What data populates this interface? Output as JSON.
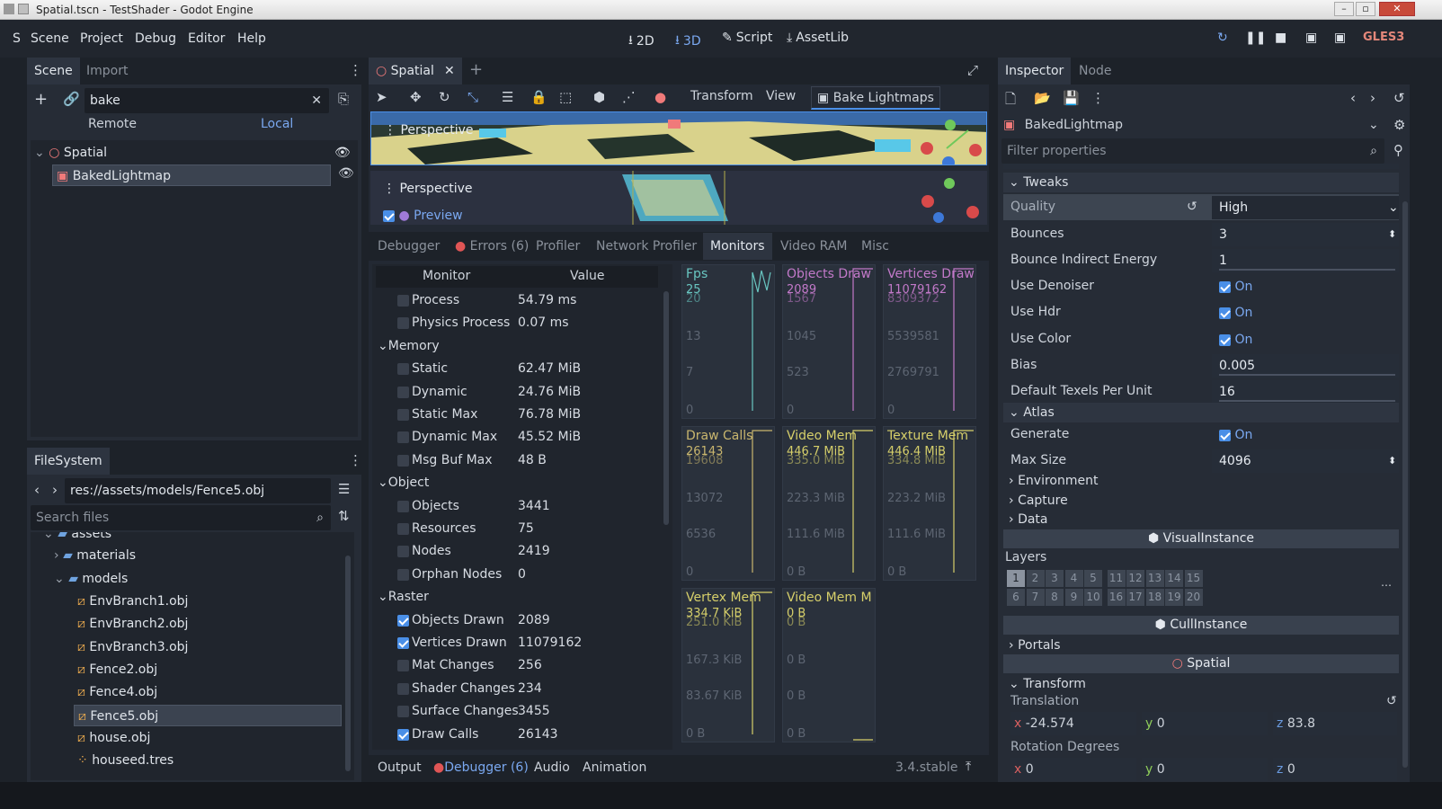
{
  "window": {
    "title": "Spatial.tscn - TestShader - Godot Engine"
  },
  "menu": {
    "items": [
      "Scene",
      "Project",
      "Debug",
      "Editor",
      "Help"
    ],
    "left_letter": "S"
  },
  "workspaces": {
    "btn_2d": "2D",
    "btn_3d": "3D",
    "btn_script": "Script",
    "btn_assetlib": "AssetLib"
  },
  "renderer": "GLES3",
  "scene_dock": {
    "tab_scene": "Scene",
    "tab_import": "Import",
    "filter_value": "bake",
    "remote": "Remote",
    "local": "Local",
    "tree": [
      {
        "label": "Spatial"
      },
      {
        "label": "BakedLightmap"
      }
    ]
  },
  "filesystem": {
    "tab": "FileSystem",
    "path": "res://assets/models/Fence5.obj",
    "search_placeholder": "Search files",
    "items": [
      {
        "label": "assets"
      },
      {
        "label": "materials"
      },
      {
        "label": "models"
      },
      {
        "label": "EnvBranch1.obj"
      },
      {
        "label": "EnvBranch2.obj"
      },
      {
        "label": "EnvBranch3.obj"
      },
      {
        "label": "Fence2.obj"
      },
      {
        "label": "Fence4.obj"
      },
      {
        "label": "Fence5.obj"
      },
      {
        "label": "house.obj"
      },
      {
        "label": "houseed.tres"
      }
    ]
  },
  "editor": {
    "tab_label": "Spatial",
    "toolbar": {
      "transform": "Transform",
      "view": "View",
      "bake": "Bake Lightmaps"
    },
    "viewport1": {
      "label": "Perspective"
    },
    "viewport2": {
      "label": "Perspective",
      "preview": "Preview"
    }
  },
  "debugger": {
    "tabs": [
      "Debugger",
      "Errors (6)",
      "Profiler",
      "Network Profiler",
      "Monitors",
      "Video RAM",
      "Misc"
    ],
    "table_header": {
      "monitor": "Monitor",
      "value": "Value"
    },
    "rows": [
      {
        "kind": "item",
        "name": "Process",
        "value": "54.79 ms",
        "checked": false
      },
      {
        "kind": "item",
        "name": "Physics Process",
        "value": "0.07 ms",
        "checked": false
      },
      {
        "kind": "cat",
        "name": "Memory"
      },
      {
        "kind": "item",
        "name": "Static",
        "value": "62.47 MiB",
        "checked": false
      },
      {
        "kind": "item",
        "name": "Dynamic",
        "value": "24.76 MiB",
        "checked": false
      },
      {
        "kind": "item",
        "name": "Static Max",
        "value": "76.78 MiB",
        "checked": false
      },
      {
        "kind": "item",
        "name": "Dynamic Max",
        "value": "45.52 MiB",
        "checked": false
      },
      {
        "kind": "item",
        "name": "Msg Buf Max",
        "value": "48 B",
        "checked": false
      },
      {
        "kind": "cat",
        "name": "Object"
      },
      {
        "kind": "item",
        "name": "Objects",
        "value": "3441",
        "checked": false
      },
      {
        "kind": "item",
        "name": "Resources",
        "value": "75",
        "checked": false
      },
      {
        "kind": "item",
        "name": "Nodes",
        "value": "2419",
        "checked": false
      },
      {
        "kind": "item",
        "name": "Orphan Nodes",
        "value": "0",
        "checked": false
      },
      {
        "kind": "cat",
        "name": "Raster"
      },
      {
        "kind": "item",
        "name": "Objects Drawn",
        "value": "2089",
        "checked": true
      },
      {
        "kind": "item",
        "name": "Vertices Drawn",
        "value": "11079162",
        "checked": true
      },
      {
        "kind": "item",
        "name": "Mat Changes",
        "value": "256",
        "checked": false
      },
      {
        "kind": "item",
        "name": "Shader Changes",
        "value": "234",
        "checked": false
      },
      {
        "kind": "item",
        "name": "Surface Changes",
        "value": "3455",
        "checked": false
      },
      {
        "kind": "item",
        "name": "Draw Calls",
        "value": "26143",
        "checked": true
      }
    ],
    "graphs": [
      {
        "title": "Fps",
        "value": "25",
        "l1": "20",
        "l2": "13",
        "l3": "7",
        "l4": "0",
        "color": "#69c7c2"
      },
      {
        "title": "Objects Draw",
        "value": "2089",
        "l1": "1567",
        "l2": "1045",
        "l3": "523",
        "l4": "0",
        "color": "#c279c9"
      },
      {
        "title": "Vertices Draw",
        "value": "11079162",
        "l1": "8309372",
        "l2": "5539581",
        "l3": "2769791",
        "l4": "0",
        "color": "#c279c9"
      },
      {
        "title": "Draw Calls",
        "value": "26143",
        "l1": "19608",
        "l2": "13072",
        "l3": "6536",
        "l4": "0",
        "color": "#c9b66e"
      },
      {
        "title": "Video Mem",
        "value": "446.7 MiB",
        "l1": "335.0 MiB",
        "l2": "223.3 MiB",
        "l3": "111.6 MiB",
        "l4": "0 B",
        "color": "#d6cf6a"
      },
      {
        "title": "Texture Mem",
        "value": "446.4 MiB",
        "l1": "334.8 MiB",
        "l2": "223.2 MiB",
        "l3": "111.6 MiB",
        "l4": "0 B",
        "color": "#d6cf6a"
      },
      {
        "title": "Vertex Mem",
        "value": "334.7 KiB",
        "l1": "251.0 KiB",
        "l2": "167.3 KiB",
        "l3": "83.67 KiB",
        "l4": "0 B",
        "color": "#d6cf6a"
      },
      {
        "title": "Video Mem M",
        "value": "0 B",
        "l1": "0 B",
        "l2": "0 B",
        "l3": "0 B",
        "l4": "0 B",
        "color": "#d6cf6a"
      }
    ]
  },
  "bottom": {
    "output": "Output",
    "debugger": "Debugger (6)",
    "audio": "Audio",
    "animation": "Animation",
    "version": "3.4.stable"
  },
  "inspector": {
    "tab_inspector": "Inspector",
    "tab_node": "Node",
    "object": "BakedLightmap",
    "filter_placeholder": "Filter properties",
    "sections": {
      "tweaks": "Tweaks",
      "atlas": "Atlas",
      "environment": "Environment",
      "capture": "Capture",
      "data": "Data",
      "portals": "Portals",
      "transform": "Transform"
    },
    "props": {
      "quality": {
        "label": "Quality",
        "value": "High"
      },
      "bounces": {
        "label": "Bounces",
        "value": "3"
      },
      "bounce_indirect": {
        "label": "Bounce Indirect Energy",
        "value": "1"
      },
      "use_denoiser": {
        "label": "Use Denoiser",
        "value": "On"
      },
      "use_hdr": {
        "label": "Use Hdr",
        "value": "On"
      },
      "use_color": {
        "label": "Use Color",
        "value": "On"
      },
      "bias": {
        "label": "Bias",
        "value": "0.005"
      },
      "texels": {
        "label": "Default Texels Per Unit",
        "value": "16"
      },
      "generate": {
        "label": "Generate",
        "value": "On"
      },
      "max_size": {
        "label": "Max Size",
        "value": "4096"
      }
    },
    "visual_instance": "VisualInstance",
    "layers_label": "Layers",
    "layers_row1": [
      "1",
      "2",
      "3",
      "4",
      "5",
      "11",
      "12",
      "13",
      "14",
      "15"
    ],
    "layers_row2": [
      "6",
      "7",
      "8",
      "9",
      "10",
      "16",
      "17",
      "18",
      "19",
      "20"
    ],
    "cull_instance": "CullInstance",
    "spatial": "Spatial",
    "translation": {
      "label": "Translation",
      "x_label": "x",
      "x": "-24.574",
      "y_label": "y",
      "y": "0",
      "z_label": "z",
      "z": "83.8"
    },
    "rotation": {
      "label": "Rotation Degrees",
      "x_label": "x",
      "x": "0",
      "y_label": "y",
      "y": "0",
      "z_label": "z",
      "z": "0"
    }
  }
}
